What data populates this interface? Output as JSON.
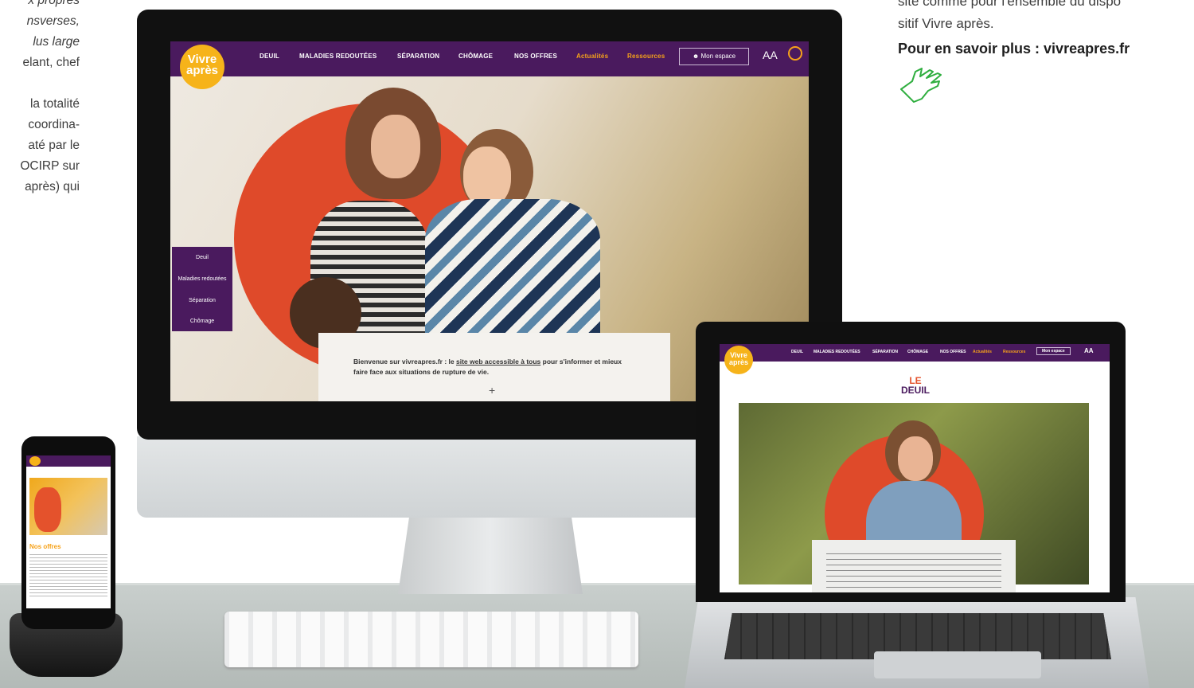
{
  "left_text": {
    "lines_italic": [
      "x propres",
      "nsverses,",
      "lus large"
    ],
    "lines_regular_1": [
      "elant, chef"
    ],
    "lines_regular_2": [
      "la totalité",
      "coordina-",
      "até par le",
      "OCIRP sur",
      "après) qui"
    ]
  },
  "right_text": {
    "line1": "site comme pour l'ensemble du dispo",
    "line2": "sitif Vivre après.",
    "cta": "Pour en savoir plus : vivreapres.fr"
  },
  "desktop_site": {
    "logo_line1": "Vivre",
    "logo_line2": "après",
    "nav": [
      "DEUIL",
      "MALADIES REDOUTÉES",
      "SÉPARATION",
      "CHÔMAGE",
      "NOS OFFRES",
      "Actualités",
      "Ressources"
    ],
    "account_label": "Mon espace",
    "text_size_label": "AA",
    "side_menu": [
      "Deuil",
      "Maladies redoutées",
      "Séparation",
      "Chômage"
    ],
    "welcome_prefix": "Bienvenue sur vivreapres.fr : le ",
    "welcome_link": "site web accessible à tous",
    "welcome_suffix": " pour s'informer et mieux faire face aux situations de rupture de vie.",
    "expand_symbol": "+"
  },
  "laptop_site": {
    "logo_line1": "Vivre",
    "logo_line2": "après",
    "nav": [
      "DEUIL",
      "MALADIES REDOUTÉES",
      "SÉPARATION",
      "CHÔMAGE",
      "NOS OFFRES",
      "Actualités",
      "Ressources"
    ],
    "account_label": "Mon espace",
    "text_size_label": "AA",
    "page_title_line1": "LE",
    "page_title_line2": "DEUIL"
  },
  "phone_site": {
    "section_title": "Nos offres"
  },
  "colors": {
    "brand_purple": "#4a1a5e",
    "brand_yellow": "#f6b31a",
    "accent_orange": "#f6a21a",
    "hero_red": "#df4a2a",
    "cta_green": "#2fae3f"
  }
}
